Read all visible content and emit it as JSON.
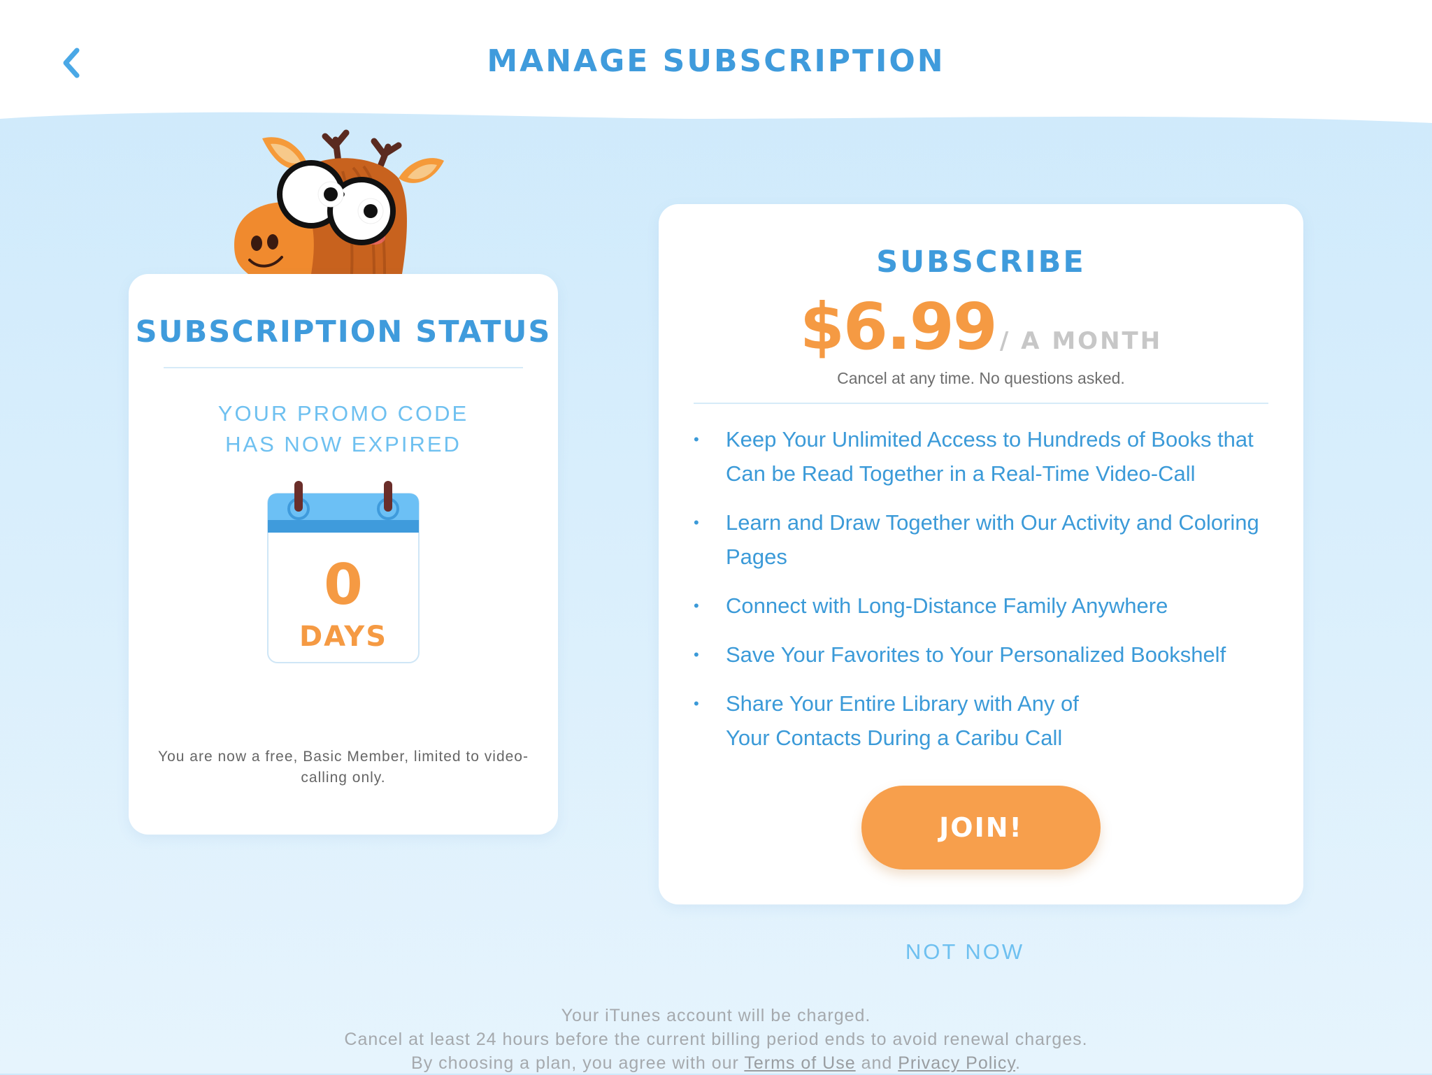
{
  "header": {
    "title": "MANAGE SUBSCRIPTION",
    "back_icon": "chevron-left-icon"
  },
  "status_card": {
    "title": "SUBSCRIPTION STATUS",
    "promo_line1": "YOUR PROMO CODE",
    "promo_line2": "HAS NOW EXPIRED",
    "days_remaining": "0",
    "days_label": "DAYS",
    "member_note": "You are now a free, Basic Member, limited to video-calling only."
  },
  "subscribe_card": {
    "title": "SUBSCRIBE",
    "price": "$6.99",
    "period": "/ A MONTH",
    "cancel_note": "Cancel at any time. No questions asked.",
    "bullet": "•",
    "features": [
      "Keep Your Unlimited Access to Hundreds of Books that Can be Read Together in a Real-Time Video-Call",
      "Learn and Draw Together with Our Activity and Coloring Pages",
      "Connect with Long-Distance Family Anywhere",
      "Save Your Favorites to Your Personalized Bookshelf",
      "Share Your Entire Library with Any of Your Contacts During a Caribu Call"
    ],
    "join_label": "JOIN!"
  },
  "not_now_label": "NOT NOW",
  "legal": {
    "line1": "Your iTunes account will be charged.",
    "line2": "Cancel at least 24 hours before the current billing period ends to avoid renewal charges.",
    "line3_prefix": "By choosing a plan, you agree with our ",
    "terms_link": "Terms of Use",
    "line3_middle": " and ",
    "privacy_link": "Privacy Policy",
    "line3_suffix": "."
  },
  "colors": {
    "primary_blue": "#3f9bdc",
    "light_blue": "#6ec0f0",
    "accent_orange": "#f59a43",
    "background": "#cde9fb"
  }
}
